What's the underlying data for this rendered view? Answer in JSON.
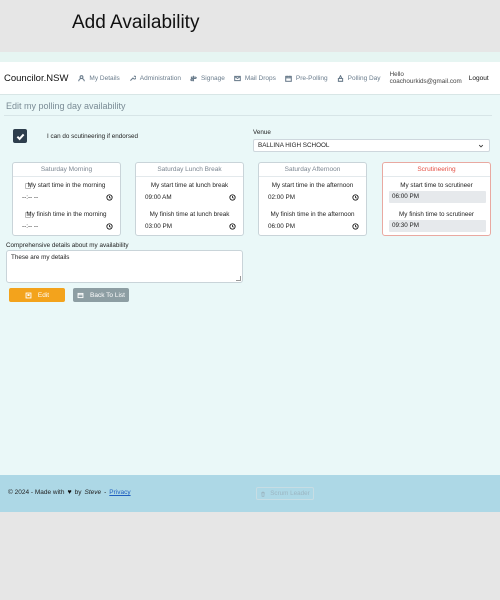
{
  "page": {
    "heading": "Add Availability"
  },
  "nav": {
    "brand": "Councilor.NSW",
    "items": [
      {
        "label": "My Details",
        "icon": "user-icon"
      },
      {
        "label": "Administration",
        "icon": "wrench-icon"
      },
      {
        "label": "Signage",
        "icon": "signpost-icon"
      },
      {
        "label": "Mail Drops",
        "icon": "envelope-icon"
      },
      {
        "label": "Pre-Polling",
        "icon": "calendar-icon"
      },
      {
        "label": "Polling Day",
        "icon": "ballot-icon"
      }
    ],
    "hello": "Hello coachourkids@gmail.com",
    "logout": "Logout"
  },
  "form": {
    "title": "Edit my polling day availability",
    "scrutineer_checkbox": {
      "label": "I can do scutineering if endorsed",
      "checked": true
    },
    "venue": {
      "label": "Venue",
      "value": "BALLINA HIGH SCHOOL"
    },
    "cards": [
      {
        "title": "Saturday Morning",
        "start_label": "My start time in the morning",
        "start_value": "--:-- --",
        "finish_label": "My finish time in the morning",
        "finish_value": "--:-- --"
      },
      {
        "title": "Saturday Lunch Break",
        "start_label": "My start time at lunch break",
        "start_value": "09:00 AM",
        "finish_label": "My finish time at lunch break",
        "finish_value": "03:00 PM"
      },
      {
        "title": "Saturday Afternoon",
        "start_label": "My start time in the afternoon",
        "start_value": "02:00 PM",
        "finish_label": "My finish time in the afternoon",
        "finish_value": "06:00 PM"
      },
      {
        "title": "Scrutineering",
        "start_label": "My start time to scrutineer",
        "start_value": "06:00 PM",
        "finish_label": "My finish time to scrutineer",
        "finish_value": "09:30 PM"
      }
    ],
    "details": {
      "label": "Comprehensive details about my availability",
      "value": "These are my details"
    },
    "edit_button": "Edit",
    "back_button": "Back To List"
  },
  "footer": {
    "copyright": "© 2024 - Made with",
    "by": "by",
    "author": "Steve",
    "separator": "-",
    "privacy": "Privacy",
    "scrum_button": "Scrum Leader"
  },
  "colors": {
    "edit_button": "#f3a31c",
    "back_button": "#8d9ea3",
    "scrutineering_title": "#e45044",
    "footer": "#add8e6",
    "main_bg": "#eaf8f8"
  }
}
